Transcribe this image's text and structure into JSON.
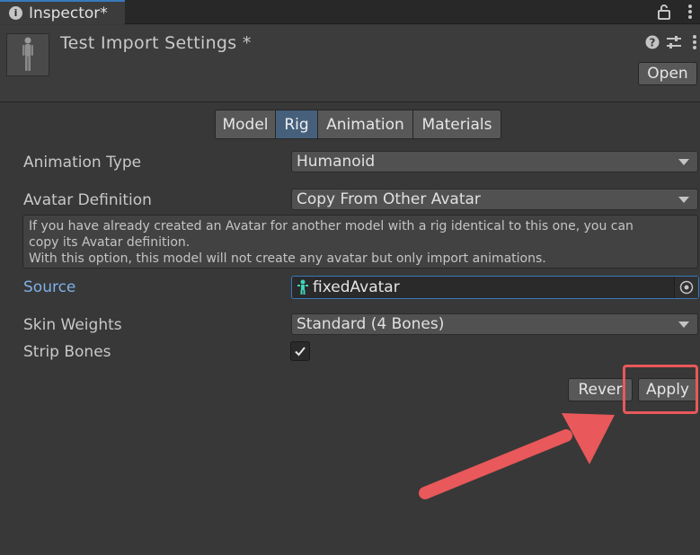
{
  "tab": {
    "title": "Inspector*",
    "icon": "info-icon"
  },
  "header": {
    "title": "Test Import Settings *",
    "open_label": "Open"
  },
  "toolbar": {
    "tabs": [
      "Model",
      "Rig",
      "Animation",
      "Materials"
    ],
    "active": "Rig"
  },
  "fields": {
    "animation_type": {
      "label": "Animation Type",
      "value": "Humanoid"
    },
    "avatar_definition": {
      "label": "Avatar Definition",
      "value": "Copy From Other Avatar"
    },
    "help_lines": [
      "If you have already created an Avatar for another model with a rig identical to this one, you can",
      "copy its Avatar definition.",
      "With this option, this model will not create any avatar but only import animations."
    ],
    "source": {
      "label": "Source",
      "value": "fixedAvatar",
      "icon": "avatar-icon"
    },
    "skin_weights": {
      "label": "Skin Weights",
      "value": "Standard (4 Bones)"
    },
    "strip_bones": {
      "label": "Strip Bones",
      "checked": true
    }
  },
  "buttons": {
    "revert": "Rever",
    "apply": "Apply"
  },
  "colors": {
    "accent": "#3a79bb",
    "annotation": "#e9585a",
    "background": "#383838"
  }
}
